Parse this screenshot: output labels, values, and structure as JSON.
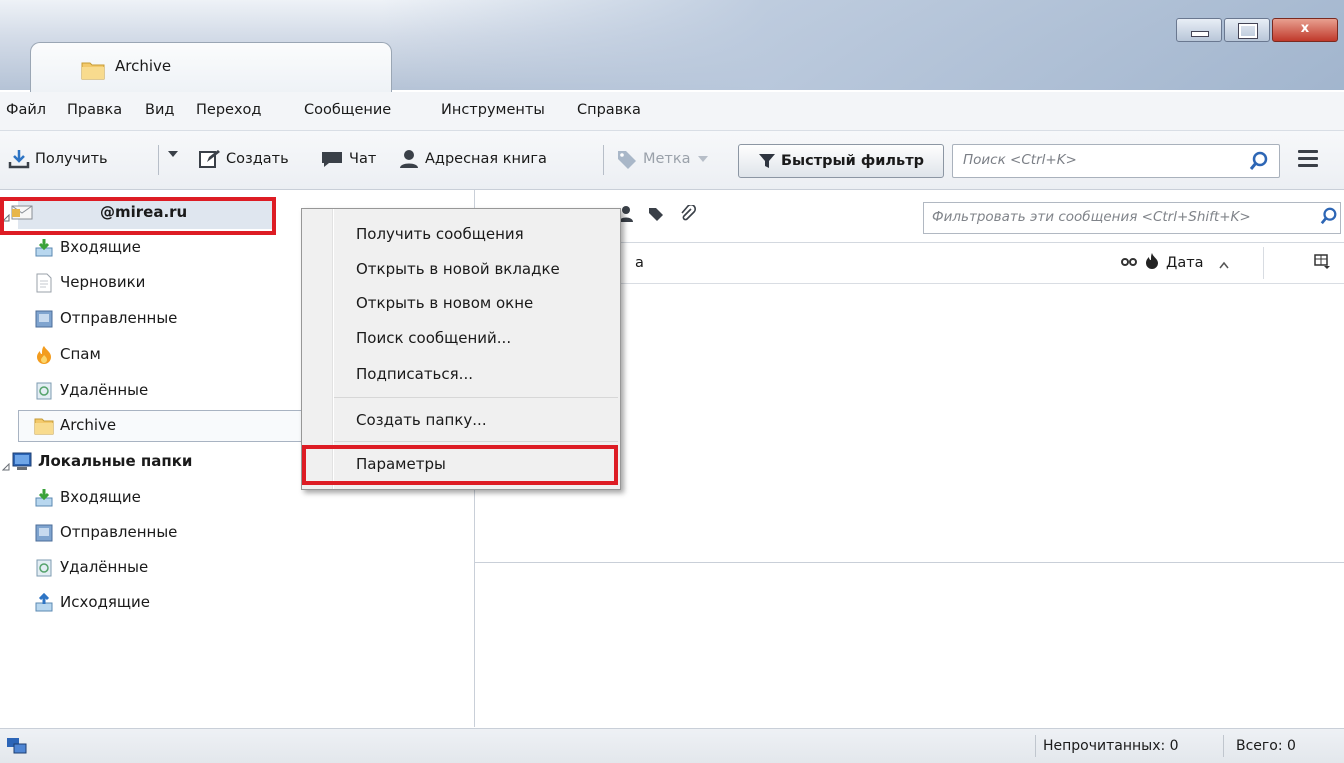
{
  "window": {
    "tab_title": "Archive",
    "controls": {
      "minimize": "–",
      "maximize": "□",
      "close": "x"
    }
  },
  "menubar": {
    "items": [
      {
        "label": "Файл"
      },
      {
        "label": "Правка"
      },
      {
        "label": "Вид"
      },
      {
        "label": "Переход"
      },
      {
        "label": "Сообщение"
      },
      {
        "label": "Инструменты"
      },
      {
        "label": "Справка"
      }
    ]
  },
  "toolbar": {
    "get_label": "Получить",
    "write_label": "Создать",
    "chat_label": "Чат",
    "address_book_label": "Адресная книга",
    "tag_label": "Метка",
    "quick_filter_label": "Быстрый фильтр",
    "search_placeholder": "Поиск <Ctrl+K>"
  },
  "sidebar": {
    "account": "@mirea.ru",
    "account_folders": [
      "Входящие",
      "Черновики",
      "Отправленные",
      "Спам",
      "Удалённые",
      "Archive"
    ],
    "local_label": "Локальные папки",
    "local_folders": [
      "Входящие",
      "Отправленные",
      "Удалённые",
      "Исходящие"
    ]
  },
  "filterbar": {
    "placeholder": "Фильтровать эти сообщения <Ctrl+Shift+K>"
  },
  "columns": {
    "subject_fragment": "а",
    "date": "Дата"
  },
  "context_menu": {
    "items": [
      "Получить сообщения",
      "Открыть в новой вкладке",
      "Открыть в новом окне",
      "Поиск сообщений...",
      "Подписаться...",
      "Создать папку...",
      "Параметры"
    ]
  },
  "statusbar": {
    "unread": "Непрочитанных: 0",
    "total": "Всего: 0"
  },
  "colors": {
    "highlight": "#dd1c24",
    "selection": "#dfe6ef"
  }
}
